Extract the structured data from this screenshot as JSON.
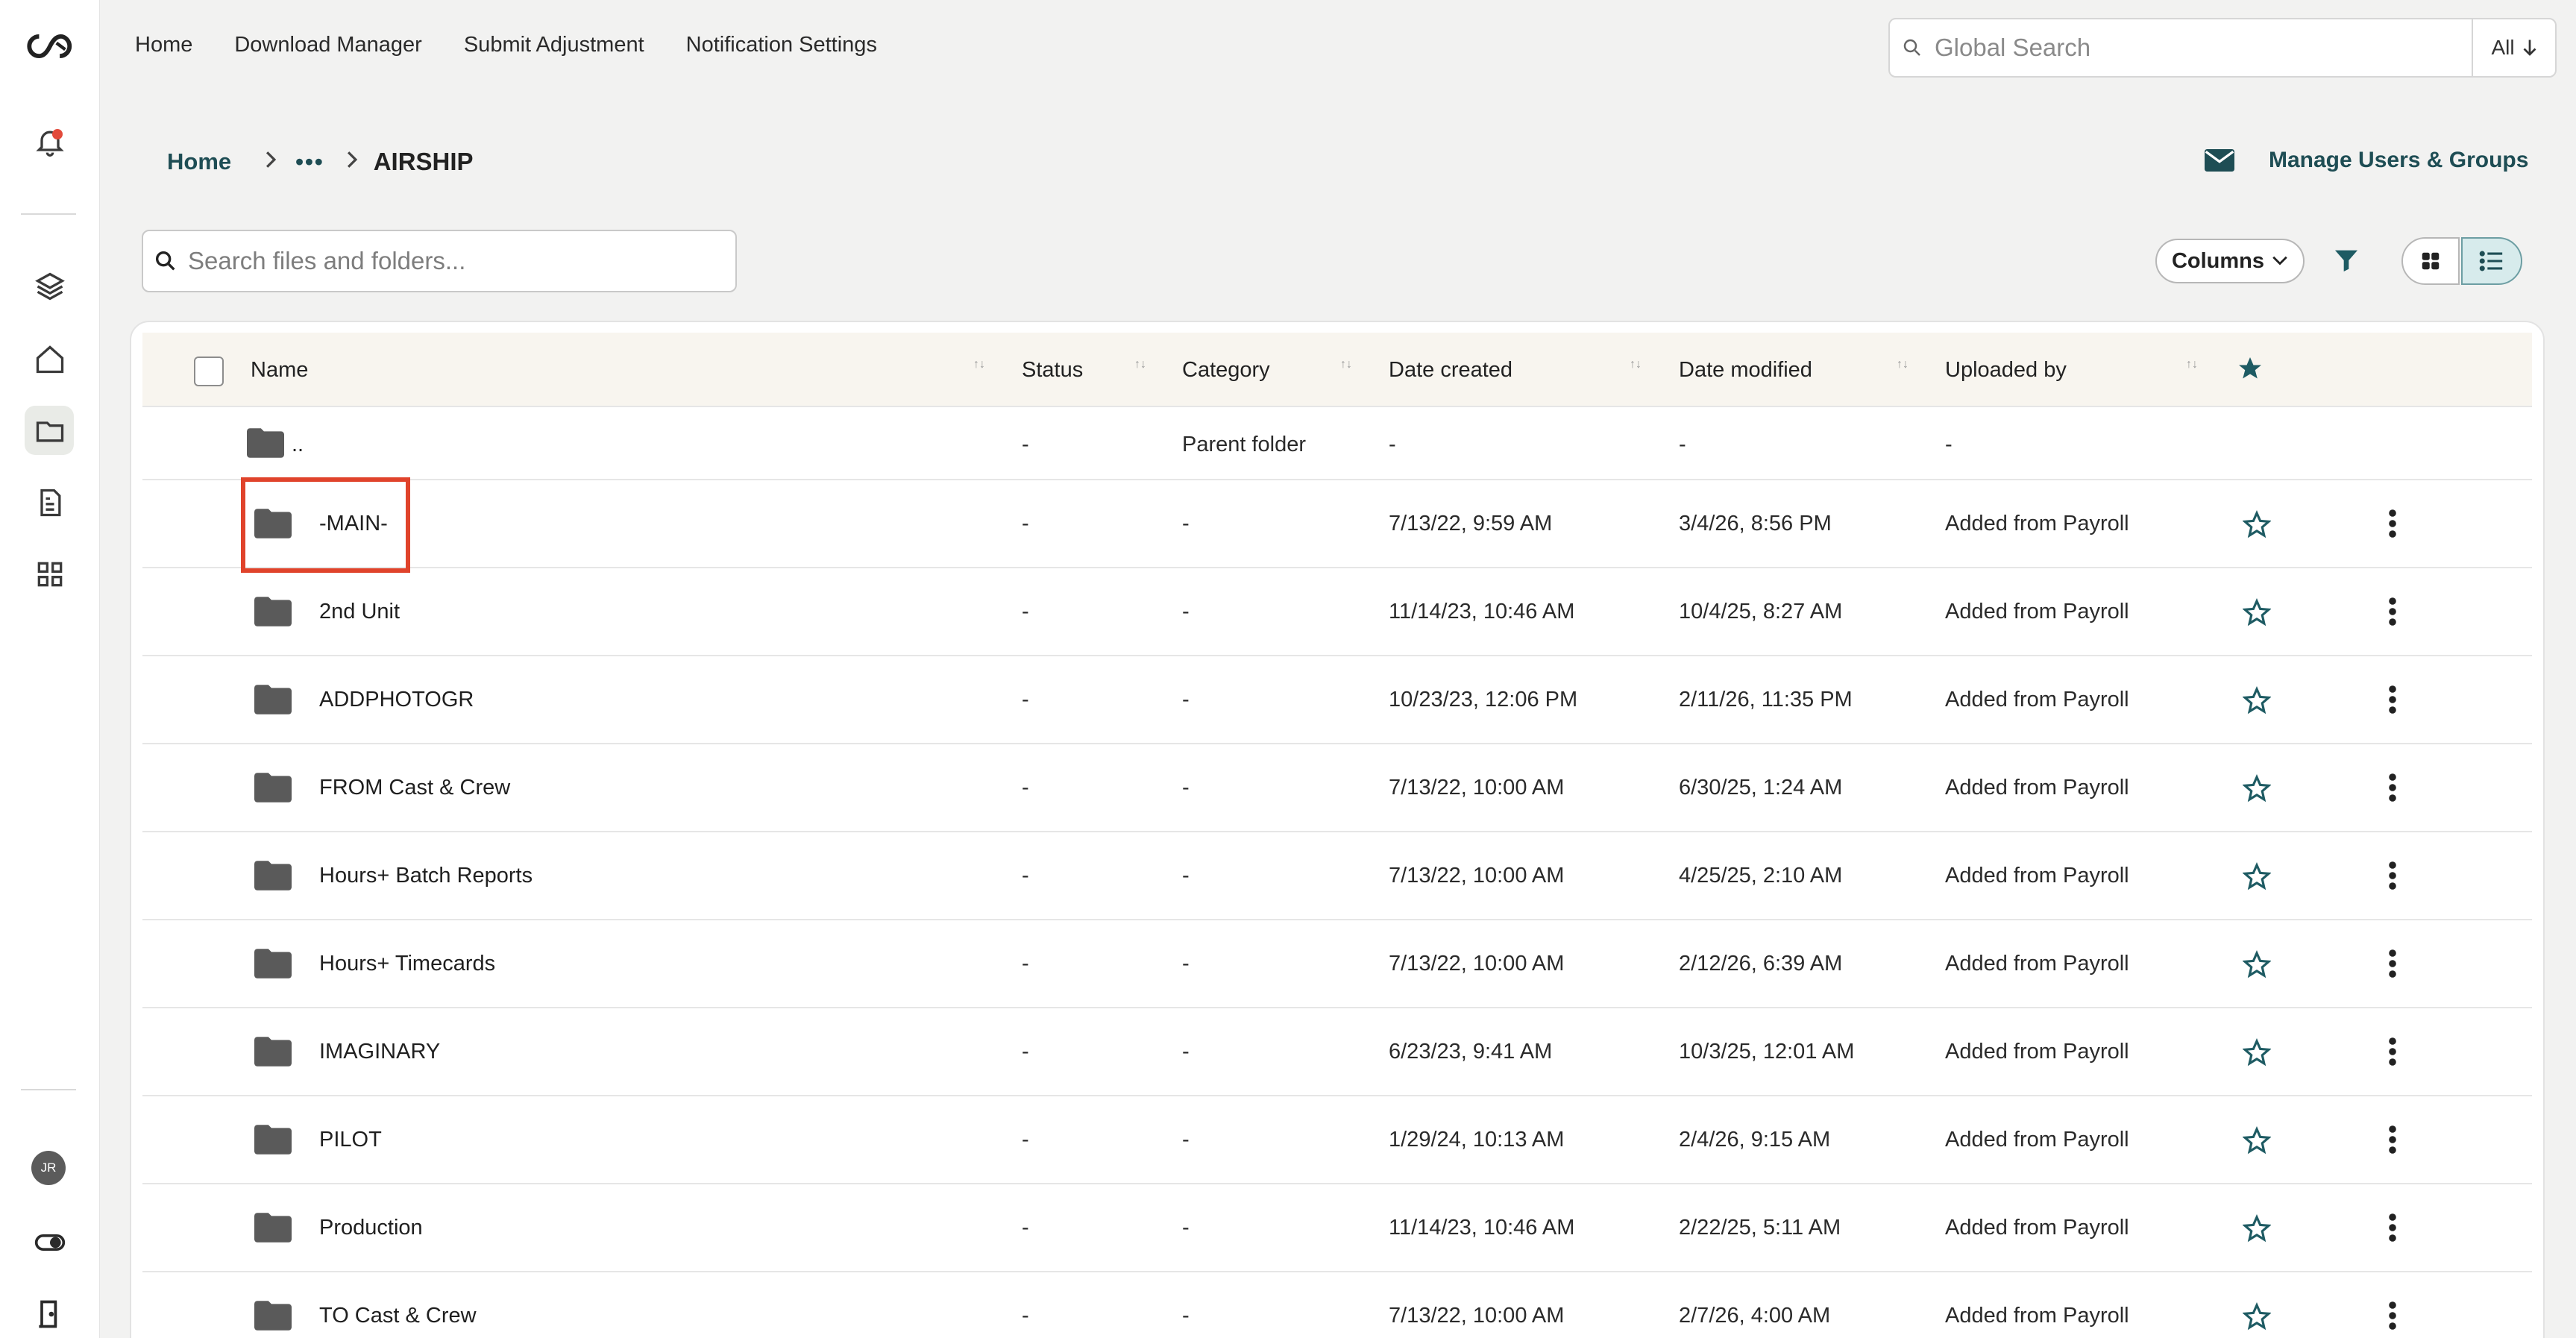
{
  "topnav": {
    "items": [
      "Home",
      "Download Manager",
      "Submit Adjustment",
      "Notification Settings"
    ]
  },
  "global_search": {
    "placeholder": "Global Search",
    "scope": "All"
  },
  "breadcrumb": {
    "home": "Home",
    "ellipsis": "•••",
    "current": "AIRSHIP"
  },
  "manage_label": "Manage Users & Groups",
  "file_search": {
    "placeholder": "Search files and folders..."
  },
  "toolbar": {
    "columns_label": "Columns"
  },
  "avatar_initials": "JR",
  "table": {
    "headers": [
      "Name",
      "Status",
      "Category",
      "Date created",
      "Date modified",
      "Uploaded by"
    ],
    "parent_row": {
      "name": "..",
      "status": "-",
      "category": "Parent folder",
      "created": "-",
      "modified": "-",
      "uploaded": "-"
    },
    "rows": [
      {
        "name": "-MAIN-",
        "status": "-",
        "category": "-",
        "created": "7/13/22, 9:59 AM",
        "modified": "3/4/26, 8:56 PM",
        "uploaded": "Added from Payroll"
      },
      {
        "name": "2nd Unit",
        "status": "-",
        "category": "-",
        "created": "11/14/23, 10:46 AM",
        "modified": "10/4/25, 8:27 AM",
        "uploaded": "Added from Payroll"
      },
      {
        "name": "ADDPHOTOGR",
        "status": "-",
        "category": "-",
        "created": "10/23/23, 12:06 PM",
        "modified": "2/11/26, 11:35 PM",
        "uploaded": "Added from Payroll"
      },
      {
        "name": "FROM Cast & Crew",
        "status": "-",
        "category": "-",
        "created": "7/13/22, 10:00 AM",
        "modified": "6/30/25, 1:24 AM",
        "uploaded": "Added from Payroll"
      },
      {
        "name": "Hours+ Batch Reports",
        "status": "-",
        "category": "-",
        "created": "7/13/22, 10:00 AM",
        "modified": "4/25/25, 2:10 AM",
        "uploaded": "Added from Payroll"
      },
      {
        "name": "Hours+ Timecards",
        "status": "-",
        "category": "-",
        "created": "7/13/22, 10:00 AM",
        "modified": "2/12/26, 6:39 AM",
        "uploaded": "Added from Payroll"
      },
      {
        "name": "IMAGINARY",
        "status": "-",
        "category": "-",
        "created": "6/23/23, 9:41 AM",
        "modified": "10/3/25, 12:01 AM",
        "uploaded": "Added from Payroll"
      },
      {
        "name": "PILOT",
        "status": "-",
        "category": "-",
        "created": "1/29/24, 10:13 AM",
        "modified": "2/4/26, 9:15 AM",
        "uploaded": "Added from Payroll"
      },
      {
        "name": "Production",
        "status": "-",
        "category": "-",
        "created": "11/14/23, 10:46 AM",
        "modified": "2/22/25, 5:11 AM",
        "uploaded": "Added from Payroll"
      },
      {
        "name": "TO Cast & Crew",
        "status": "-",
        "category": "-",
        "created": "7/13/22, 10:00 AM",
        "modified": "2/7/26, 4:00 AM",
        "uploaded": "Added from Payroll"
      }
    ]
  },
  "colors": {
    "accent": "#1e4d54",
    "highlight": "#e0432b",
    "header_bg": "#f8f5ef"
  }
}
